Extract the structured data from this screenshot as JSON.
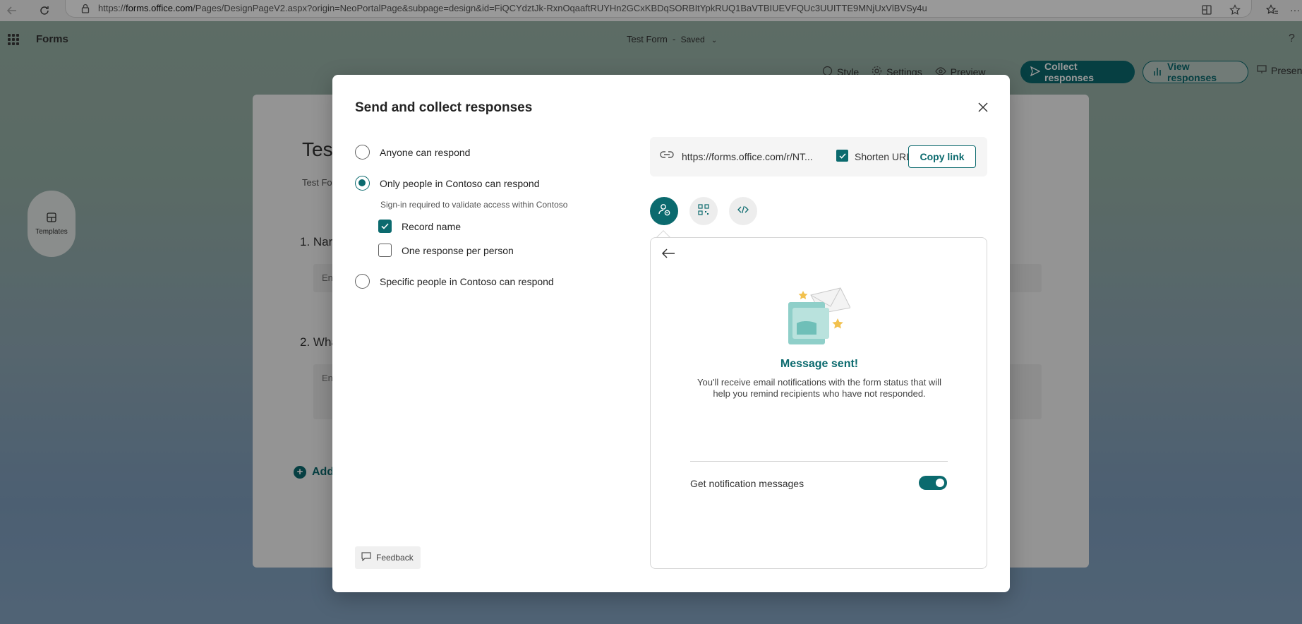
{
  "browser": {
    "url_prefix": "https://",
    "url_domain": "forms.office.com",
    "url_path": "/Pages/DesignPageV2.aspx?origin=NeoPortalPage&subpage=design&id=FiQCYdztJk-RxnOqaaftRUYHn2GCxKBDqSORBItYpkRUQ1BaVTBIUEVFQUc3UUITTE9MNjUxVlBVSy4u"
  },
  "app": {
    "name": "Forms",
    "form_title": "Test Form",
    "separator": "-",
    "save_status": "Saved",
    "help": "?"
  },
  "toolbar": {
    "style": "Style",
    "settings": "Settings",
    "preview": "Preview",
    "collect_responses": "Collect responses",
    "view_responses": "View responses",
    "present": "Presen"
  },
  "sidebar": {
    "templates": "Templates"
  },
  "background_form": {
    "title": "Test",
    "subtitle": "Test Fo",
    "q1": "1. Nar",
    "q1_placeholder": "En",
    "q2": "2. Wha",
    "q2_placeholder": "En",
    "add_new": "Add"
  },
  "dialog": {
    "title": "Send and collect responses",
    "options": [
      {
        "label": "Anyone can respond",
        "selected": false
      },
      {
        "label": "Only people in Contoso can respond",
        "selected": true
      },
      {
        "label": "Specific people in Contoso can respond",
        "selected": false
      }
    ],
    "signin_hint": "Sign-in required to validate access within Contoso",
    "checks": [
      {
        "label": "Record name",
        "checked": true
      },
      {
        "label": "One response per person",
        "checked": false
      }
    ],
    "feedback": "Feedback",
    "link": {
      "url": "https://forms.office.com/r/NT...",
      "shorten_label": "Shorten URL",
      "shorten_checked": true,
      "copy_label": "Copy link"
    },
    "share_tabs": [
      "invite-icon",
      "qr-code-icon",
      "embed-icon"
    ],
    "panel": {
      "message_title": "Message sent!",
      "message_body": "You'll receive email notifications with the form status that will help you remind recipients who have not responded.",
      "notification_label": "Get notification messages",
      "notification_on": true
    }
  },
  "colors": {
    "accent": "#0b6a6e",
    "overlay": "rgba(0,0,0,0.40)"
  }
}
